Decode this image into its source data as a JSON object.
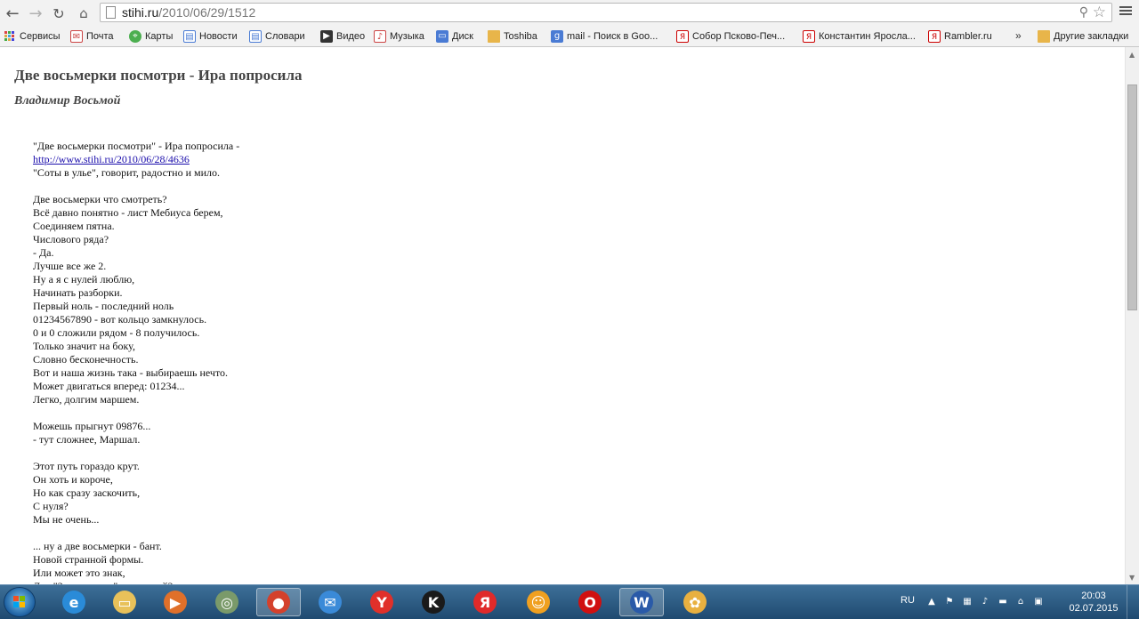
{
  "browser": {
    "url_domain": "stihi.ru",
    "url_path": "/2010/06/29/1512",
    "icons": {
      "back": "back-arrow-icon",
      "forward": "forward-arrow-icon",
      "reload": "reload-icon",
      "home": "home-icon",
      "page": "page-icon",
      "zoom": "zoom-icon",
      "bookmark": "star-icon",
      "menu": "menu-icon"
    }
  },
  "bookmarks": [
    {
      "label": "Сервисы",
      "icon": "apps-icon"
    },
    {
      "label": "Почта",
      "icon": "mail-icon"
    },
    {
      "label": "Карты",
      "icon": "maps-icon"
    },
    {
      "label": "Новости",
      "icon": "news-icon"
    },
    {
      "label": "Словари",
      "icon": "dictionary-icon"
    },
    {
      "label": "Видео",
      "icon": "video-icon"
    },
    {
      "label": "Музыка",
      "icon": "music-icon"
    },
    {
      "label": "Диск",
      "icon": "disk-icon"
    },
    {
      "label": "Toshiba",
      "icon": "folder-icon"
    },
    {
      "label": "mail - Поиск в Goo...",
      "icon": "google-icon"
    },
    {
      "label": "Собор Псково-Печ...",
      "icon": "yandex-icon"
    },
    {
      "label": "Константин Яросла...",
      "icon": "yandex-icon"
    },
    {
      "label": "Rambler.ru",
      "icon": "yandex-icon"
    }
  ],
  "bookmarks_more": "»",
  "other_bookmarks": "Другие закладки",
  "page": {
    "title": "Две восьмерки посмотри - Ира попросила",
    "author": "Владимир Восьмой",
    "poem_lines": [
      "\"Две восьмерки посмотри\" - Ира попросила -",
      "http://www.stihi.ru/2010/06/28/4636",
      "\"Соты в улье\", говорит, радостно и мило.",
      "",
      "Две восьмерки что смотреть?",
      "Всё давно понятно - лист Мебиуса берем,",
      "Соединяем пятна.",
      "Числового ряда?",
      "- Да.",
      "Лучше все же 2.",
      "Ну а я с нулей люблю,",
      "Начинать разборки.",
      "Первый ноль - последний ноль",
      "01234567890 - вот кольцо замкнулось.",
      "0 и 0 сложили рядом - 8 получилось.",
      "Только значит на боку,",
      "Словно бесконечность.",
      "Вот и наша жизнь така - выбираешь нечто.",
      "Может двигаться вперед: 01234...",
      "Легко, долгим маршем.",
      "",
      "Можешь прыгнут 09876...",
      "- тут сложнее, Маршал.",
      "",
      "Этот путь гораздо крут.",
      "Он хоть и короче,",
      "Но как сразу заскочить,",
      "С нуля?",
      "Мы не очень...",
      "",
      "... ну а две восьмерки - бант.",
      "Новой странной формы.",
      "Или может это знак,",
      "Для \"Знаменитых\" личностей?"
    ],
    "link_line_index": 1
  },
  "taskbar": {
    "start": "start-icon",
    "items": [
      {
        "name": "ie-icon",
        "glyph": "e",
        "color": "#2a8bd8",
        "active": false
      },
      {
        "name": "explorer-icon",
        "glyph": "▭",
        "color": "#e8c15a",
        "active": false
      },
      {
        "name": "media-player-icon",
        "glyph": "▶",
        "color": "#e0702a",
        "active": false
      },
      {
        "name": "app-circle-icon",
        "glyph": "◎",
        "color": "#7a9a6a",
        "active": false
      },
      {
        "name": "chrome-icon",
        "glyph": "●",
        "color": "#d4412c",
        "active": true
      },
      {
        "name": "mail-app-icon",
        "glyph": "✉",
        "color": "#3a8ad8",
        "active": false
      },
      {
        "name": "yandex-browser-icon",
        "glyph": "Y",
        "color": "#e0302a",
        "active": false
      },
      {
        "name": "kaspersky-icon",
        "glyph": "K",
        "color": "#1a1a1a",
        "active": false
      },
      {
        "name": "yandex-icon",
        "glyph": "Я",
        "color": "#e02a2a",
        "active": false
      },
      {
        "name": "smiley-app-icon",
        "glyph": "☺",
        "color": "#f0a020",
        "active": false
      },
      {
        "name": "opera-icon",
        "glyph": "O",
        "color": "#d01010",
        "active": false
      },
      {
        "name": "word-icon",
        "glyph": "W",
        "color": "#2a5aa8",
        "active": true
      },
      {
        "name": "paint-app-icon",
        "glyph": "✿",
        "color": "#e8b040",
        "active": false
      }
    ],
    "language": "RU",
    "time": "20:03",
    "date": "02.07.2015"
  }
}
